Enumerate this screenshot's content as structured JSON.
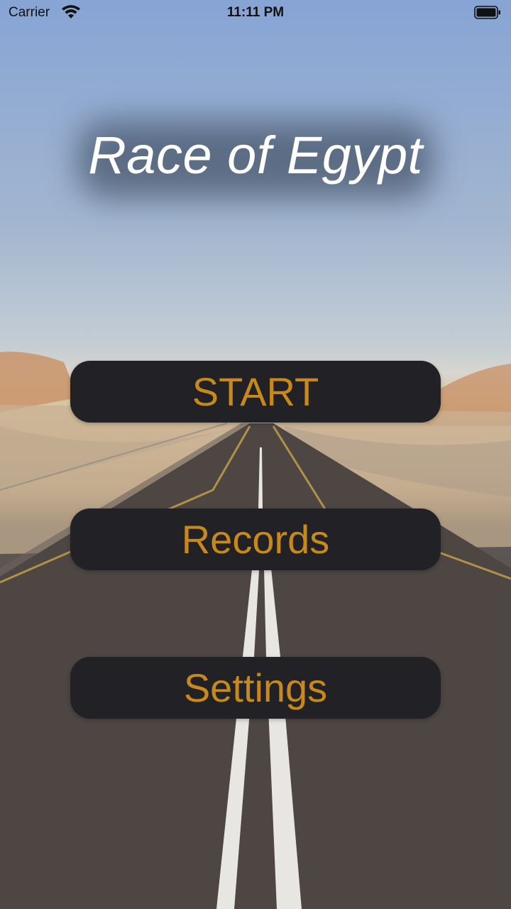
{
  "status_bar": {
    "carrier": "Carrier",
    "time": "11:11 PM",
    "wifi_icon": "wifi-icon",
    "battery_icon": "battery-icon"
  },
  "title": "Race of Egypt",
  "menu": {
    "start_label": "START",
    "records_label": "Records",
    "settings_label": "Settings"
  },
  "colors": {
    "button_background": "#222226",
    "button_text": "#c8891c",
    "title_text": "#ffffff"
  }
}
